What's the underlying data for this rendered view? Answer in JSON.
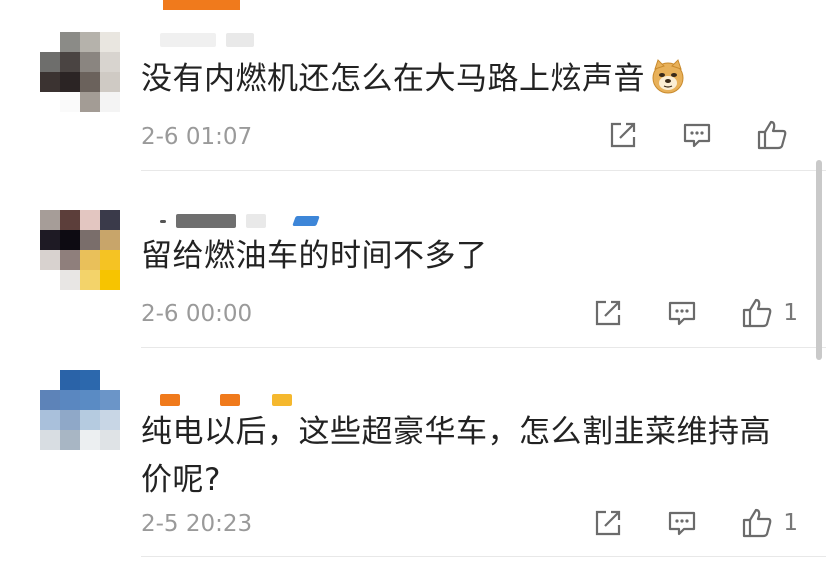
{
  "comments": [
    {
      "text": "没有内燃机还怎么在大马路上炫声音",
      "time": "2-6 01:07",
      "likes": "",
      "emoji": "doge-emoji",
      "avatar_colors": [
        "#ffffff",
        "#8b8b87",
        "#b5b2ab",
        "#e9e6e0",
        "#6e6e6c",
        "#4a4442",
        "#8a8580",
        "#d8d4cf",
        "#3b3331",
        "#2b2424",
        "#6b625c",
        "#cfcac4",
        "#ffffff",
        "#fafafa",
        "#a39c95",
        "#f4f4f4"
      ]
    },
    {
      "text": "留给燃油车的时间不多了",
      "time": "2-6 00:00",
      "likes": "1",
      "avatar_colors": [
        "#a69d98",
        "#5c3e3a",
        "#e3c6c1",
        "#3a3a4a",
        "#1e1a24",
        "#0d0b12",
        "#7a6e6b",
        "#c8a56a",
        "#d8d2cf",
        "#8f7f7c",
        "#e9c05a",
        "#f5c323",
        "#ffffff",
        "#e8e6e4",
        "#f3d36a",
        "#f7c400"
      ]
    },
    {
      "text": "纯电以后，这些超豪华车，怎么割韭菜维持高价呢?",
      "time": "2-5 20:23",
      "likes": "1",
      "avatar_colors": [
        "#ffffff",
        "#2a63a8",
        "#2c68ad",
        "#ffffff",
        "#5d83b8",
        "#5a87c0",
        "#5a8bc4",
        "#6b95c8",
        "#a9c0db",
        "#8fa8c8",
        "#b5cbe0",
        "#c8d6e5",
        "#d8dde2",
        "#a8b6c4",
        "#eceff1",
        "#dfe3e6"
      ]
    }
  ],
  "icons": {
    "share": "share-icon",
    "reply": "comment-icon",
    "like": "thumbs-up-icon"
  }
}
